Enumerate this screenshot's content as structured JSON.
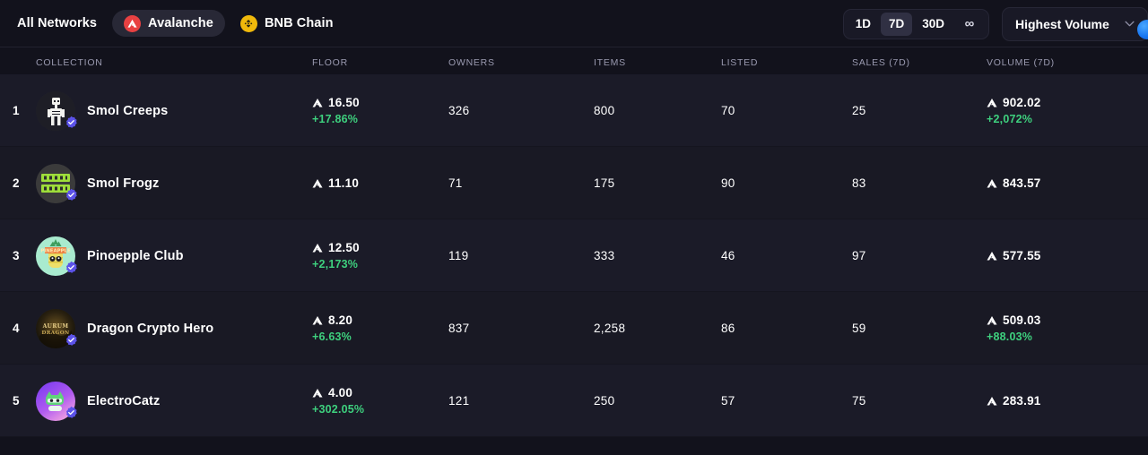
{
  "networks": {
    "items": [
      {
        "label": "All Networks",
        "icon": "none",
        "active": false
      },
      {
        "label": "Avalanche",
        "icon": "avax-icon",
        "active": true
      },
      {
        "label": "BNB Chain",
        "icon": "bnb-icon",
        "active": false
      }
    ]
  },
  "timerange": {
    "options": [
      {
        "label": "1D",
        "active": false
      },
      {
        "label": "7D",
        "active": true
      },
      {
        "label": "30D",
        "active": false
      },
      {
        "label": "∞",
        "active": false
      }
    ]
  },
  "sort": {
    "selected": "Highest Volume",
    "chevron": "chevron-down-icon"
  },
  "table": {
    "columns": [
      "COLLECTION",
      "FLOOR",
      "OWNERS",
      "ITEMS",
      "LISTED",
      "SALES (7D)",
      "VOLUME (7D)"
    ],
    "rows": [
      {
        "rank": "1",
        "name": "Smol Creeps",
        "verified": true,
        "avatar": "smol-creeps",
        "floor": "16.50",
        "floor_change": "+17.86%",
        "owners": "326",
        "items": "800",
        "listed": "70",
        "sales": "25",
        "volume": "902.02",
        "volume_change": "+2,072%"
      },
      {
        "rank": "2",
        "name": "Smol Frogz",
        "verified": true,
        "avatar": "smol-frogz",
        "floor": "11.10",
        "floor_change": "",
        "owners": "71",
        "items": "175",
        "listed": "90",
        "sales": "83",
        "volume": "843.57",
        "volume_change": ""
      },
      {
        "rank": "3",
        "name": "Pinoepple Club",
        "verified": true,
        "avatar": "pinoepple-club",
        "floor": "12.50",
        "floor_change": "+2,173%",
        "owners": "119",
        "items": "333",
        "listed": "46",
        "sales": "97",
        "volume": "577.55",
        "volume_change": ""
      },
      {
        "rank": "4",
        "name": "Dragon Crypto Hero",
        "verified": true,
        "avatar": "dragon-crypto-hero",
        "floor": "8.20",
        "floor_change": "+6.63%",
        "owners": "837",
        "items": "2,258",
        "listed": "86",
        "sales": "59",
        "volume": "509.03",
        "volume_change": "+88.03%"
      },
      {
        "rank": "5",
        "name": "ElectroCatz",
        "verified": true,
        "avatar": "electrocatz",
        "floor": "4.00",
        "floor_change": "+302.05%",
        "owners": "121",
        "items": "250",
        "listed": "57",
        "sales": "75",
        "volume": "283.91",
        "volume_change": ""
      }
    ]
  },
  "colors": {
    "background": "#12121c",
    "row_odd": "#1b1b28",
    "row_even": "#191924",
    "positive": "#3ed07e",
    "accent_avax": "#e84142",
    "accent_bnb": "#f0b90b",
    "badge_purple": "#5b52e8"
  }
}
